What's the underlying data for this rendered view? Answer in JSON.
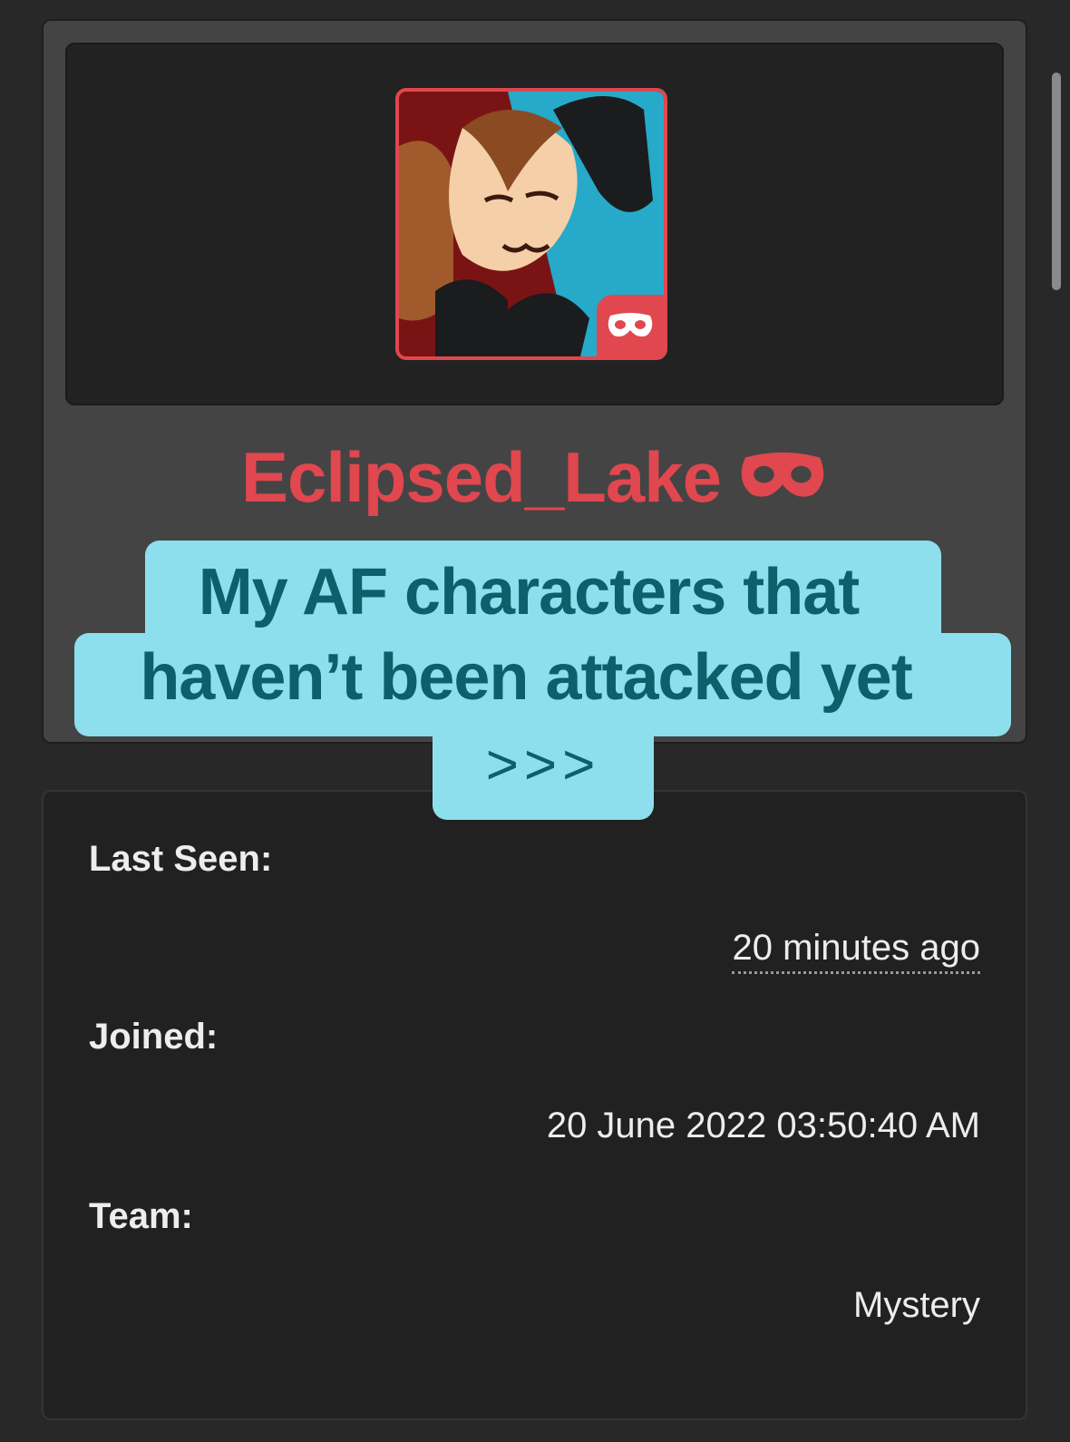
{
  "profile": {
    "username": "Eclipsed_Lake",
    "badge_icon": "mask-icon",
    "accent_color": "#e0474f"
  },
  "caption": {
    "line1": "My AF characters that",
    "line2": "haven’t been attacked yet",
    "line3": ">>>",
    "background_color": "#8edfee",
    "text_color": "#0d5f6b"
  },
  "stats": {
    "last_seen_label": "Last Seen:",
    "last_seen_value": "20 minutes ago",
    "joined_label": "Joined:",
    "joined_value": "20 June 2022 03:50:40 AM",
    "team_label": "Team:",
    "team_value": "Mystery"
  }
}
